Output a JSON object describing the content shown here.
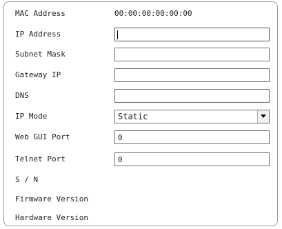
{
  "fields": {
    "mac_address": {
      "label": "MAC Address",
      "value": "00:00:00:00:00:00"
    },
    "ip_address": {
      "label": "IP Address",
      "value": ""
    },
    "subnet_mask": {
      "label": "Subnet Mask",
      "value": ""
    },
    "gateway_ip": {
      "label": "Gateway IP",
      "value": ""
    },
    "dns": {
      "label": "DNS",
      "value": ""
    },
    "ip_mode": {
      "label": "IP Mode",
      "value": "Static",
      "icon": "chevron-down-icon"
    },
    "web_gui_port": {
      "label": "Web GUI Port",
      "value": "0"
    },
    "telnet_port": {
      "label": "Telnet Port",
      "value": "0"
    },
    "serial_number": {
      "label": "S / N",
      "value": ""
    },
    "firmware_version": {
      "label": "Firmware Version",
      "value": ""
    },
    "hardware_version": {
      "label": "Hardware Version",
      "value": ""
    }
  }
}
